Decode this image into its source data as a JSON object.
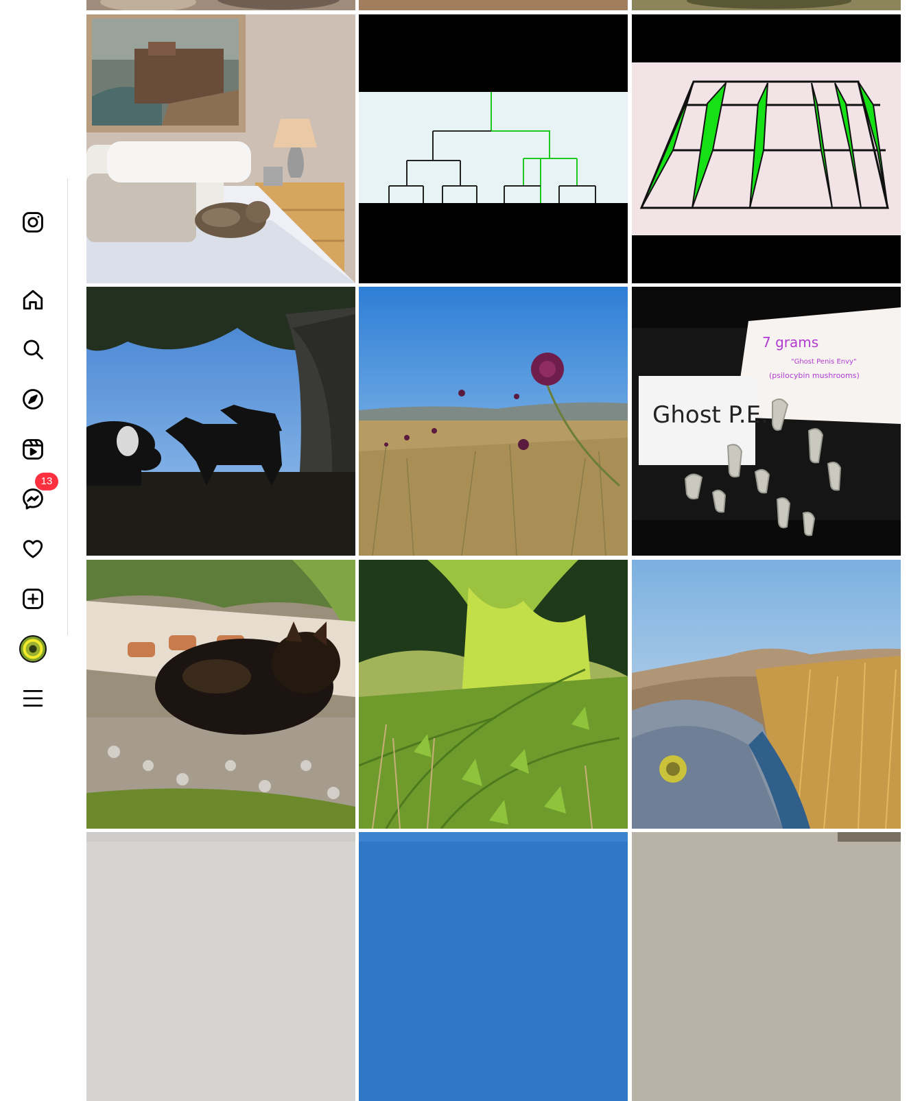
{
  "sidebar": {
    "logo_icon": "instagram-icon",
    "items": [
      {
        "id": "home",
        "icon": "home-icon"
      },
      {
        "id": "search",
        "icon": "search-icon"
      },
      {
        "id": "explore",
        "icon": "compass-icon"
      },
      {
        "id": "reels",
        "icon": "reels-icon"
      },
      {
        "id": "messages",
        "icon": "messenger-icon",
        "badge": "13"
      },
      {
        "id": "notifications",
        "icon": "heart-icon"
      },
      {
        "id": "create",
        "icon": "plus-square-icon"
      },
      {
        "id": "profile",
        "icon": "avatar"
      },
      {
        "id": "more",
        "icon": "menu-icon"
      }
    ],
    "badge_color": "#ff3040"
  },
  "posts": {
    "mushroom_note": {
      "line1": "7 grams",
      "line2": "\"Ghost Penis Envy\"",
      "line3": "(psilocybin mushrooms)",
      "label": "Ghost P.E."
    }
  }
}
